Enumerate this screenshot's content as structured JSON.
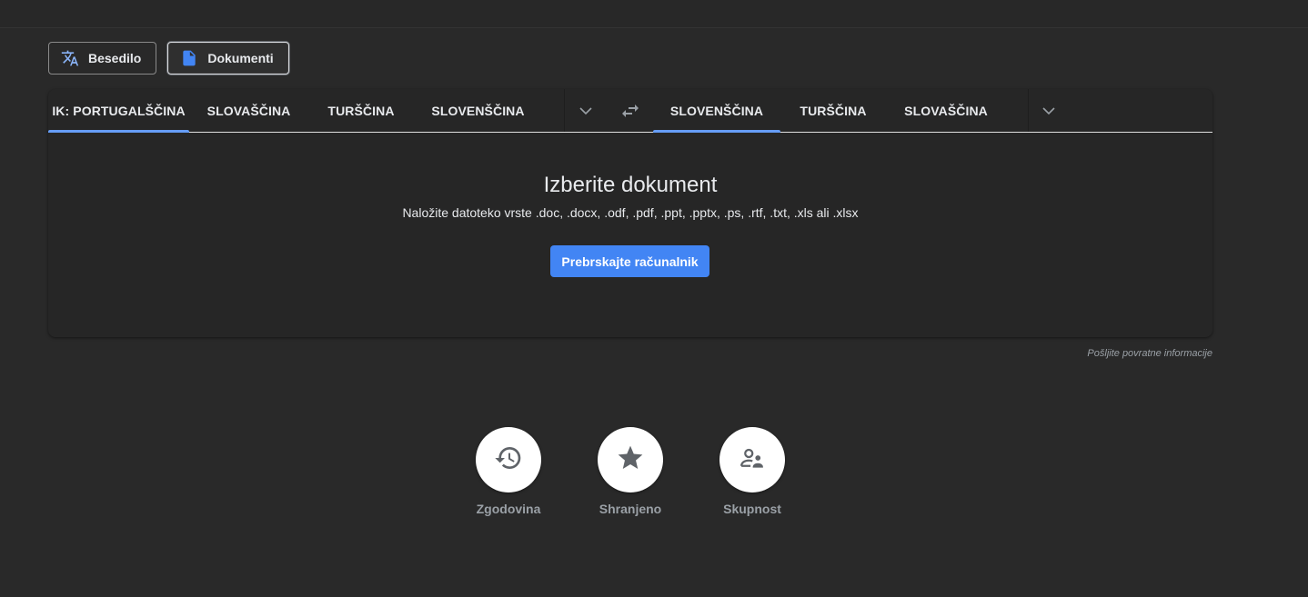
{
  "modes": {
    "text_label": "Besedilo",
    "docs_label": "Dokumenti",
    "text_icon": "translate-icon",
    "docs_icon": "document-icon"
  },
  "source_languages": [
    "IK: PORTUGALŠČINA",
    "SLOVAŠČINA",
    "TURŠČINA",
    "SLOVENŠČINA"
  ],
  "target_languages": [
    "SLOVENŠČINA",
    "TURŠČINA",
    "SLOVAŠČINA"
  ],
  "source_selected_index": 0,
  "target_selected_index": 0,
  "upload": {
    "title": "Izberite dokument",
    "subtitle": "Naložite datoteko vrste .doc, .docx, .odf, .pdf, .ppt, .pptx, .ps, .rtf, .txt, .xls ali .xlsx",
    "browse_label": "Prebrskajte računalnik"
  },
  "feedback_label": "Pošljite povratne informacije",
  "shortcuts": [
    {
      "label": "Zgodovina",
      "icon": "history-icon"
    },
    {
      "label": "Shranjeno",
      "icon": "star-icon"
    },
    {
      "label": "Skupnost",
      "icon": "community-icon"
    }
  ],
  "colors": {
    "background": "#292929",
    "accent": "#4285f4",
    "tab_indicator": "#669df6"
  }
}
